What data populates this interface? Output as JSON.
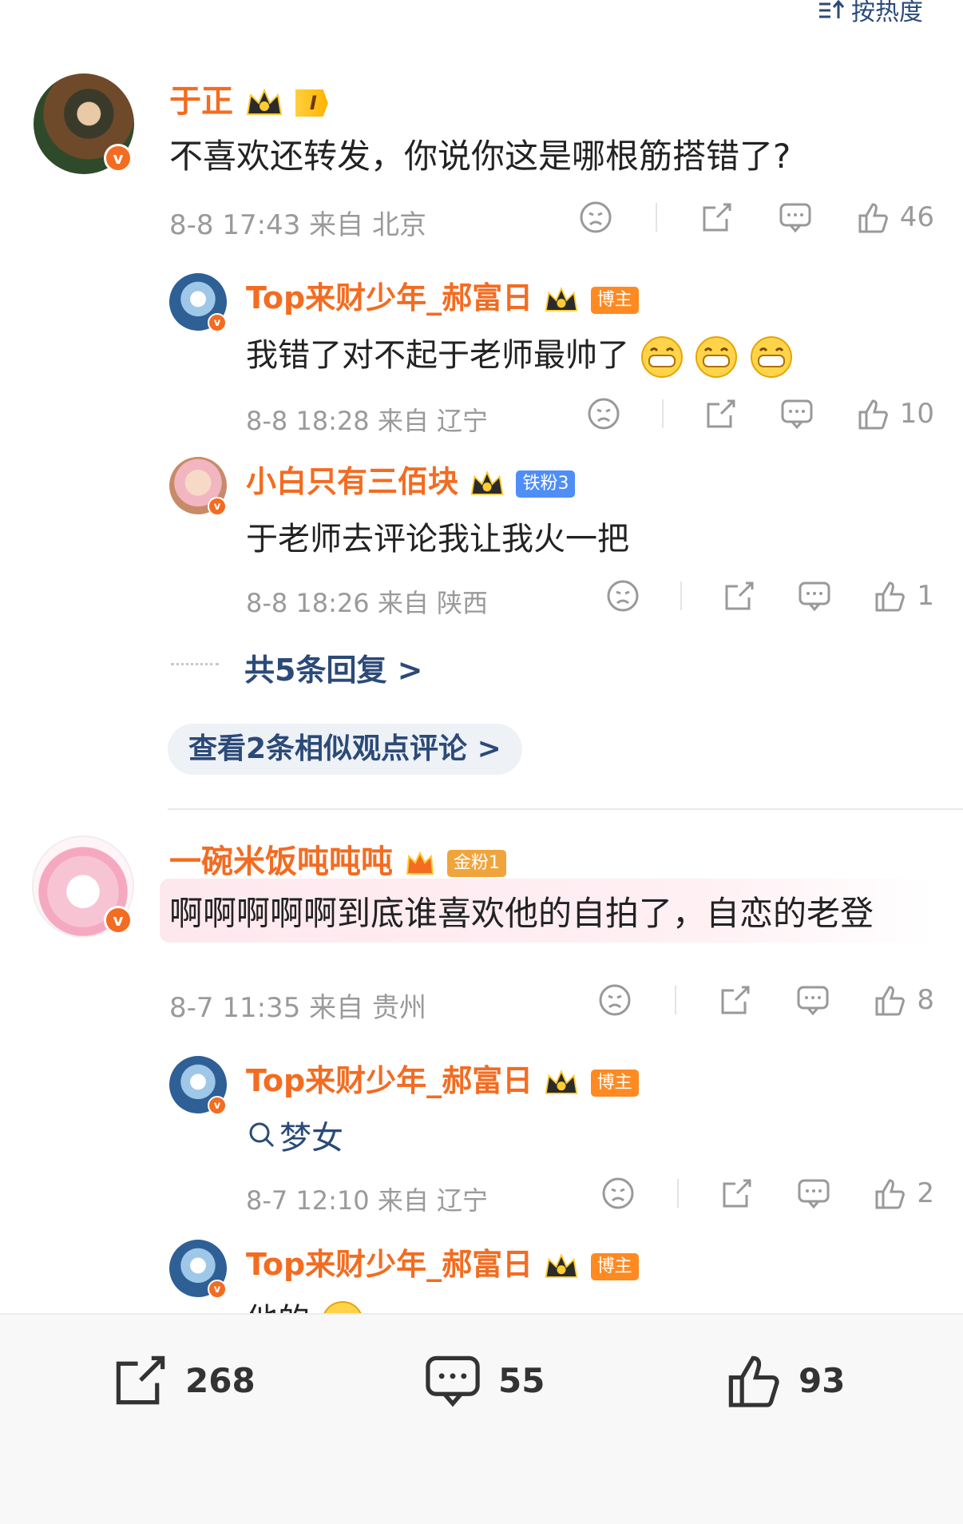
{
  "sort_label": "按热度",
  "comments": [
    {
      "user": "于正",
      "rank_badge": "I",
      "text": "不喜欢还转发，你说你这是哪根筋搭错了?",
      "time": "8-8 17:43",
      "location": "来自 北京",
      "likes": "46",
      "replies": [
        {
          "user": "Top来财少年_郝富日",
          "tag": "博主",
          "text": "我错了对不起于老师最帅了",
          "time": "8-8 18:28",
          "location": "来自 辽宁",
          "likes": "10"
        },
        {
          "user": "小白只有三佰块",
          "tag": "铁粉3",
          "text": "于老师去评论我让我火一把",
          "time": "8-8 18:26",
          "location": "来自 陕西",
          "likes": "1"
        }
      ],
      "more_replies": "共5条回复 >",
      "similar": "查看2条相似观点评论 >"
    },
    {
      "user": "一碗米饭吨吨吨",
      "tag": "金粉1",
      "text": "啊啊啊啊啊到底谁喜欢他的自拍了，自恋的老登",
      "time": "8-7 11:35",
      "location": "来自 贵州",
      "likes": "8",
      "replies": [
        {
          "user": "Top来财少年_郝富日",
          "tag": "博主",
          "text": "梦女",
          "time": "8-7 12:10",
          "location": "来自 辽宁",
          "likes": "2"
        },
        {
          "user": "Top来财少年_郝富日",
          "tag": "博主",
          "text": "他的"
        }
      ]
    }
  ],
  "bottom_bar": {
    "reposts": "268",
    "comments": "55",
    "likes": "93"
  },
  "colors": {
    "accent": "#f36c21",
    "link": "#2b4a78"
  }
}
